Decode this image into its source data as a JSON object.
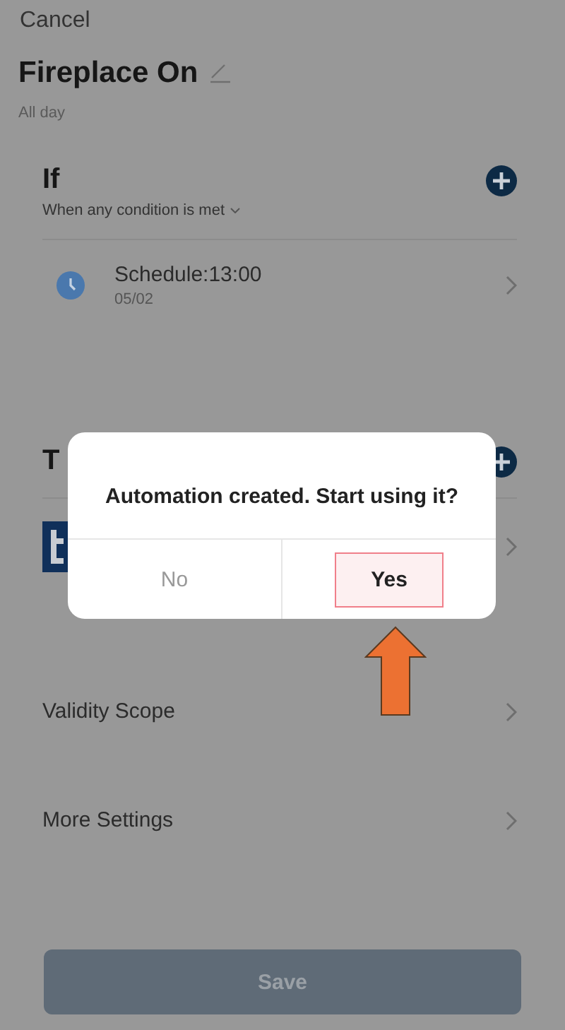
{
  "header": {
    "cancel": "Cancel",
    "title": "Fireplace On",
    "subtitle": "All day"
  },
  "if_section": {
    "heading": "If",
    "condition_mode": "When any condition is met",
    "conditions": [
      {
        "title": "Schedule:13:00",
        "detail": "05/02"
      }
    ]
  },
  "then_section": {
    "heading": "T"
  },
  "settings": [
    {
      "label": "Validity Scope"
    },
    {
      "label": "More Settings"
    }
  ],
  "save_button": {
    "label": "Save",
    "disabled": true
  },
  "dialog": {
    "message": "Automation created. Start using it?",
    "buttons": [
      {
        "label": "No",
        "selected": false
      },
      {
        "label": "Yes",
        "selected": true
      }
    ]
  }
}
